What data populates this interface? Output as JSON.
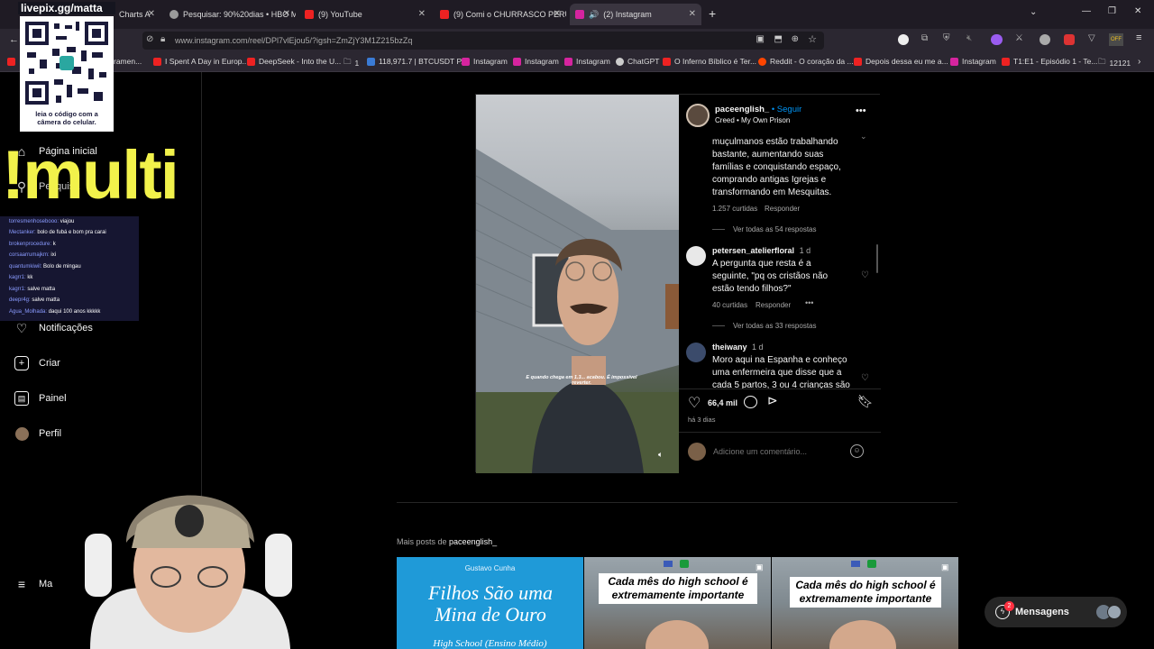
{
  "browser": {
    "tabs": [
      {
        "title": "Charts A",
        "color": "#3a6"
      },
      {
        "title": "Pesquisar: 90%20dias • HBO Ma",
        "color": "#888"
      },
      {
        "title": "(9) YouTube",
        "color": "#e22"
      },
      {
        "title": "(9) Comi o CHURRASCO PERUA",
        "color": "#e22"
      },
      {
        "title": "(2) Instagram",
        "color": "#d6249f"
      }
    ],
    "url": "www.instagram.com/reel/DPl7vlEjou5/?igsh=ZmZjY3M1Z215bzZq",
    "bookmarks": [
      "ramen...",
      "I Spent A Day in Europ...",
      "DeepSeek - Into the U...",
      "1",
      "118,971.7 | BTCUSDT P...",
      "Instagram",
      "Instagram",
      "Instagram",
      "ChatGPT",
      "O Inferno Bíblico é Ter...",
      "Reddit - O coração da ...",
      "Depois dessa eu me a...",
      "Instagram",
      "T1:E1 - Episódio 1 - Te...",
      "12121"
    ]
  },
  "stream_overlay": {
    "qr_label": "livepix.gg/matta",
    "qr_caption_1": "leia o código com a",
    "qr_caption_2": "câmera do celular.",
    "banner": "!multi",
    "chat": [
      {
        "user": "torresmenhosebooo:",
        "msg": "viajou"
      },
      {
        "user": "Mectanker:",
        "msg": "bolo de fubá e bom pra carai"
      },
      {
        "user": "brokenprocedure:",
        "msg": "k"
      },
      {
        "user": "corsaarrumajkm:",
        "msg": "ixi"
      },
      {
        "user": "quantumkiwil:",
        "msg": "Bolo de mingau"
      },
      {
        "user": "kagrr1:",
        "msg": "kk"
      },
      {
        "user": "kagrr1:",
        "msg": "salve matta"
      },
      {
        "user": "deepr4g:",
        "msg": "salve matta"
      },
      {
        "user": "Agua_Molhada:",
        "msg": "daqui 100 anos kkkkk"
      }
    ]
  },
  "sidebar": {
    "items": [
      {
        "label": "Página inicial",
        "icon": "home-icon"
      },
      {
        "label": "Pesquisa",
        "icon": "search-icon"
      },
      {
        "label": "Notificações",
        "icon": "heart-icon"
      },
      {
        "label": "Criar",
        "icon": "plus-icon"
      },
      {
        "label": "Painel",
        "icon": "dashboard-icon"
      },
      {
        "label": "Perfil",
        "icon": "avatar-icon"
      }
    ],
    "more_label": "Ma"
  },
  "post": {
    "username": "paceenglish_",
    "follow": "• Seguir",
    "audio_artist": "Creed",
    "audio_track": "• My Own Prison",
    "video_caption": "E quando chega em 1.3... acabou. É impossível reverter.",
    "comments": [
      {
        "user": "",
        "text": "muçulmanos estão trabalhando bastante, aumentando suas famílias e conquistando espaço, comprando antigas Igrejas e transformando em Mesquitas.",
        "likes": "1.257 curtidas",
        "reply": "Responder",
        "view_replies": "Ver todas as 54 respostas"
      },
      {
        "user": "petersen_atelierfloral",
        "time": "1 d",
        "text": "A pergunta que resta é a seguinte, \"pq os cristãos não estão tendo filhos?\"",
        "likes": "40 curtidas",
        "reply": "Responder",
        "view_replies": "Ver todas as 33 respostas"
      },
      {
        "user": "theiwany",
        "time": "1 d",
        "text": "Moro aqui na Espanha e conheço uma enfermeira que disse que a cada 5 partos, 3 ou 4 crianças são"
      }
    ],
    "like_count": "66,4 mil",
    "posted": "há 3 dias",
    "comment_placeholder": "Adicione um comentário..."
  },
  "more_posts": {
    "label": "Mais posts de",
    "user": "paceenglish_",
    "thumbs": [
      {
        "top": "Gustavo Cunha",
        "title": "Filhos São uma Mina de Ouro",
        "sub": "High School (Ensino Médio)"
      },
      {
        "title": "Cada mês do high school é extremamente importante"
      },
      {
        "title": "Cada mês do high school é extremamente importante"
      }
    ]
  },
  "messages": {
    "label": "Mensagens",
    "badge": "2"
  },
  "colors": {
    "accent": "#0095f6",
    "overlay_yellow": "#f2f24b"
  }
}
